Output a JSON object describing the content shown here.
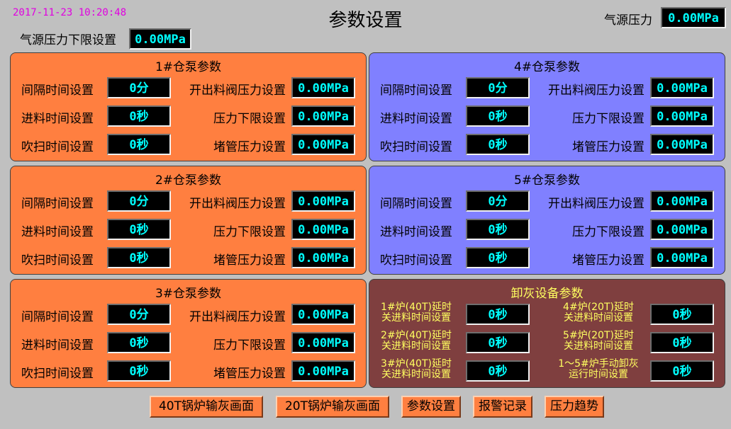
{
  "header": {
    "datetime": "2017-11-23   10:20:48",
    "title": "参数设置",
    "air_source_lower_label": "气源压力下限设置",
    "air_source_lower_value": "0.00MPa",
    "air_pressure_label": "气源压力",
    "air_pressure_value": "0.00MPa"
  },
  "pumps": [
    {
      "title": "1#仓泵参数",
      "interval_label": "间隔时间设置",
      "interval": "0分",
      "feed_label": "进料时间设置",
      "feed": "0秒",
      "purge_label": "吹扫时间设置",
      "purge": "0秒",
      "open_label": "开出料阀压力设置",
      "open": "0.00MPa",
      "lower_label": "压力下限设置",
      "lower": "0.00MPa",
      "block_label": "堵管压力设置",
      "block": "0.00MPa"
    },
    {
      "title": "2#仓泵参数",
      "interval_label": "间隔时间设置",
      "interval": "0分",
      "feed_label": "进料时间设置",
      "feed": "0秒",
      "purge_label": "吹扫时间设置",
      "purge": "0秒",
      "open_label": "开出料阀压力设置",
      "open": "0.00MPa",
      "lower_label": "压力下限设置",
      "lower": "0.00MPa",
      "block_label": "堵管压力设置",
      "block": "0.00MPa"
    },
    {
      "title": "3#仓泵参数",
      "interval_label": "间隔时间设置",
      "interval": "0分",
      "feed_label": "进料时间设置",
      "feed": "0秒",
      "purge_label": "吹扫时间设置",
      "purge": "0秒",
      "open_label": "开出料阀压力设置",
      "open": "0.00MPa",
      "lower_label": "压力下限设置",
      "lower": "0.00MPa",
      "block_label": "堵管压力设置",
      "block": "0.00MPa"
    },
    {
      "title": "4#仓泵参数",
      "interval_label": "间隔时间设置",
      "interval": "0分",
      "feed_label": "进料时间设置",
      "feed": "0秒",
      "purge_label": "吹扫时间设置",
      "purge": "0秒",
      "open_label": "开出料阀压力设置",
      "open": "0.00MPa",
      "lower_label": "压力下限设置",
      "lower": "0.00MPa",
      "block_label": "堵管压力设置",
      "block": "0.00MPa"
    },
    {
      "title": "5#仓泵参数",
      "interval_label": "间隔时间设置",
      "interval": "0分",
      "feed_label": "进料时间设置",
      "feed": "0秒",
      "purge_label": "吹扫时间设置",
      "purge": "0秒",
      "open_label": "开出料阀压力设置",
      "open": "0.00MPa",
      "lower_label": "压力下限设置",
      "lower": "0.00MPa",
      "block_label": "堵管压力设置",
      "block": "0.00MPa"
    }
  ],
  "discharge": {
    "title": "卸灰设备参数",
    "items": [
      {
        "line1": "1#炉(40T)延时",
        "line2": "关进料时间设置",
        "value": "0秒"
      },
      {
        "line1": "2#炉(40T)延时",
        "line2": "关进料时间设置",
        "value": "0秒"
      },
      {
        "line1": "3#炉(40T)延时",
        "line2": "关进料时间设置",
        "value": "0秒"
      },
      {
        "line1": "4#炉(20T)延时",
        "line2": "关进料时间设置",
        "value": "0秒"
      },
      {
        "line1": "5#炉(20T)延时",
        "line2": "关进料时间设置",
        "value": "0秒"
      },
      {
        "line1": "1～5#炉手动卸灰",
        "line2": "运行时间设置",
        "value": "0秒"
      }
    ]
  },
  "nav": {
    "btn_40t": "40T锅炉输灰画面",
    "btn_20t": "20T锅炉输灰画面",
    "btn_params": "参数设置",
    "btn_alarm": "报警记录",
    "btn_trend": "压力趋势"
  },
  "colors": {
    "background": "#c0c0c0",
    "pump_panel_left": "#ff7f40",
    "pump_panel_right": "#8080ff",
    "discharge_panel": "#7f3f3f",
    "value_text": "#00ffff",
    "datetime_text": "#e000e0"
  }
}
